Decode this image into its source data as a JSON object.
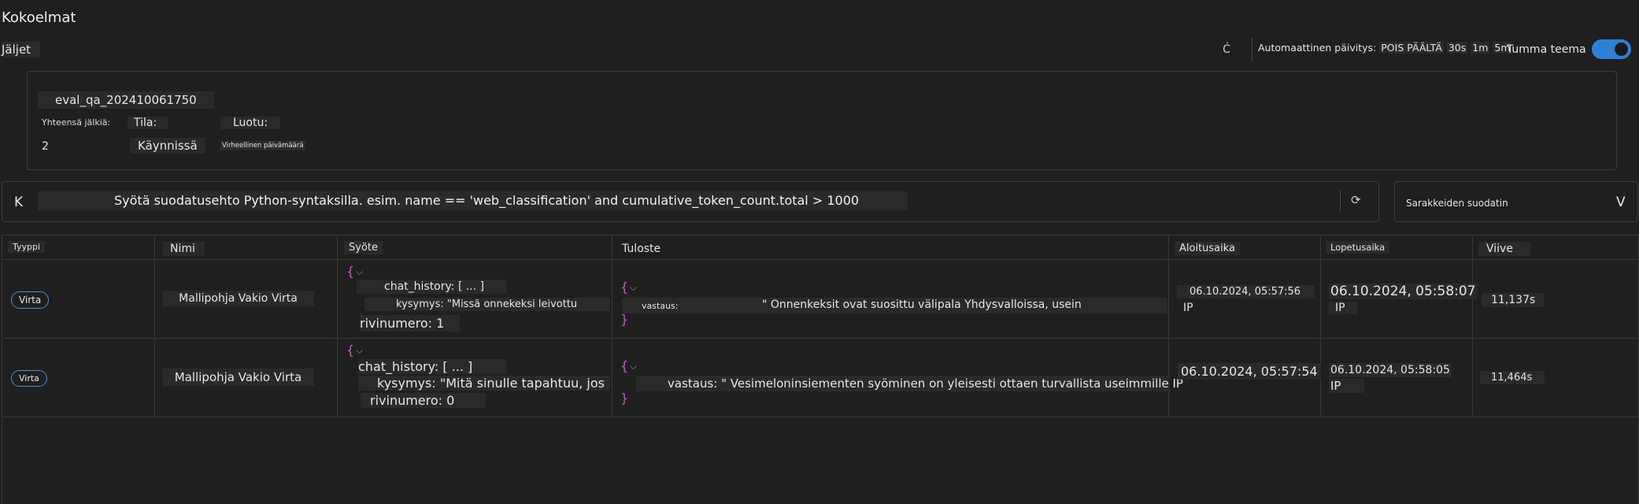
{
  "header": {
    "title": "Kokoelmat",
    "breadcrumb": "Jäljet",
    "refresh_icon": "Ċ",
    "auto_refresh_label": "Automaattinen päivitys:",
    "auto_refresh_off": "POIS PÄÄLTÄ",
    "auto_refresh_opts": [
      "30s",
      "1m",
      "5m"
    ],
    "theme_label": "Tumma teema",
    "theme_on": true,
    "accent_color": "#2f7fd6"
  },
  "run_info": {
    "name": "eval_qa_202410061750",
    "total_traces_label": "Yhteensä jälkiä:",
    "total_traces_value": "2",
    "status_label": "Tila:",
    "status_value": "Käynnissä",
    "created_label": "Luotu:",
    "created_value": "Virheellinen päivämäärä"
  },
  "filter": {
    "key_hint": "K",
    "placeholder": "Syötä suodatusehto Python-syntaksilla. esim. name == 'web_classification' and cumulative_token_count.total > 1000",
    "reset_icon": "⟳"
  },
  "column_filter": {
    "label": "Sarakkeiden suodatin",
    "chevron": "V"
  },
  "table": {
    "headers": [
      "Tyyppi",
      "Nimi",
      "Syöte",
      "Tuloste",
      "Aloitusaika",
      "Lopetusaika",
      "Viive"
    ],
    "rows": [
      {
        "type": "Virta",
        "name": "Mallipohja Vakio Virta",
        "input_open": "{",
        "input_chat": "chat_history: [ ... ]",
        "input_q": "kysymys: \"Missä onnekeksi leivottu",
        "input_row": "rivinumero: 1",
        "output_open": "{",
        "output_key": "vastaus:",
        "output_val": "\" Onnenkeksit ovat suosittu välipala Yhdysvalloissa, usein",
        "output_close": "}",
        "start": "06.10.2024, 05:57:56",
        "start_ip": "IP",
        "end": "06.10.2024, 05:58:07",
        "end_ip": "IP",
        "latency": "11,137s"
      },
      {
        "type": "Virta",
        "name": "Mallipohja Vakio Virta",
        "input_open": "{",
        "input_chat": "chat_history: [ ... ]",
        "input_q": "kysymys: \"Mitä sinulle tapahtuu, jos",
        "input_row": "rivinumero: 0",
        "output_open": "{",
        "output_key": "vastaus:",
        "output_val": "\" Vesimeloninsiementen syöminen on yleisesti ottaen turvallista useimmille IP",
        "output_close": "}",
        "start": "06.10.2024, 05:57:54",
        "start_ip": "",
        "end": "06.10.2024, 05:58:05",
        "end_ip": "IP",
        "latency": "11,464s"
      }
    ]
  }
}
